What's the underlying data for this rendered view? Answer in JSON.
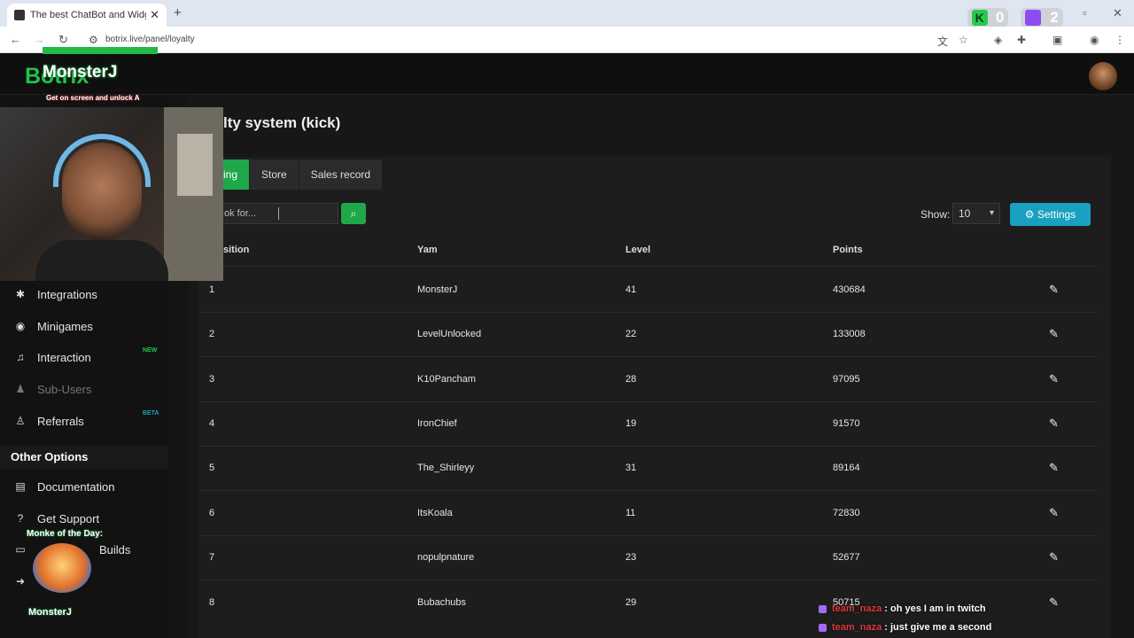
{
  "browser": {
    "tab_title": "The best ChatBot and Widgets",
    "url": "botrix.live/panel/loyalty",
    "kick_count": "0",
    "twitch_count": "2"
  },
  "app": {
    "logo": "Botrix",
    "page_title": "lty system (kick)"
  },
  "sidebar": {
    "items": [
      {
        "label": "Integrations",
        "icon": "puzzle-icon"
      },
      {
        "label": "Minigames",
        "icon": "gamepad-icon"
      },
      {
        "label": "Interaction",
        "icon": "music-icon",
        "tag": "NEW"
      },
      {
        "label": "Sub-Users",
        "icon": "users-icon"
      },
      {
        "label": "Referrals",
        "icon": "user-plus-icon",
        "tag": "BETA"
      }
    ],
    "section_title": "Other Options",
    "other_items": [
      {
        "label": "Documentation",
        "icon": "book-icon"
      },
      {
        "label": "Get Support",
        "icon": "question-icon"
      },
      {
        "label": "Builds",
        "icon": "laptop-icon"
      }
    ]
  },
  "tabs": [
    "ing",
    "Store",
    "Sales record"
  ],
  "search": {
    "placeholder": "ok for..."
  },
  "show": {
    "label": "Show:",
    "value": "10"
  },
  "settings_label": "Settings",
  "table": {
    "headers": [
      "sition",
      "Yam",
      "Level",
      "Points"
    ],
    "rows": [
      {
        "pos": "1",
        "name": "MonsterJ",
        "level": "41",
        "points": "430684"
      },
      {
        "pos": "2",
        "name": "LevelUnlocked",
        "level": "22",
        "points": "133008"
      },
      {
        "pos": "3",
        "name": "K10Pancham",
        "level": "28",
        "points": "97095"
      },
      {
        "pos": "4",
        "name": "IronChief",
        "level": "19",
        "points": "91570"
      },
      {
        "pos": "5",
        "name": "The_Shirleyy",
        "level": "31",
        "points": "89164"
      },
      {
        "pos": "6",
        "name": "ItsKoala",
        "level": "11",
        "points": "72830"
      },
      {
        "pos": "7",
        "name": "nopulpnature",
        "level": "23",
        "points": "52677"
      },
      {
        "pos": "8",
        "name": "Bubachubs",
        "level": "29",
        "points": "50715"
      }
    ]
  },
  "overlay": {
    "title": "MonsterJ",
    "subtitle": "Get on screen and unlock A",
    "monke_label": "Monke of the Day:",
    "monster_label": "MonsterJ"
  },
  "chat": [
    {
      "user": "team_naza",
      "message": ": oh yes I am in twitch"
    },
    {
      "user": "team_naza",
      "message": ": just give me a second"
    }
  ],
  "colors": {
    "accent_green": "#1fa84a",
    "settings_blue": "#1aa0c0"
  }
}
